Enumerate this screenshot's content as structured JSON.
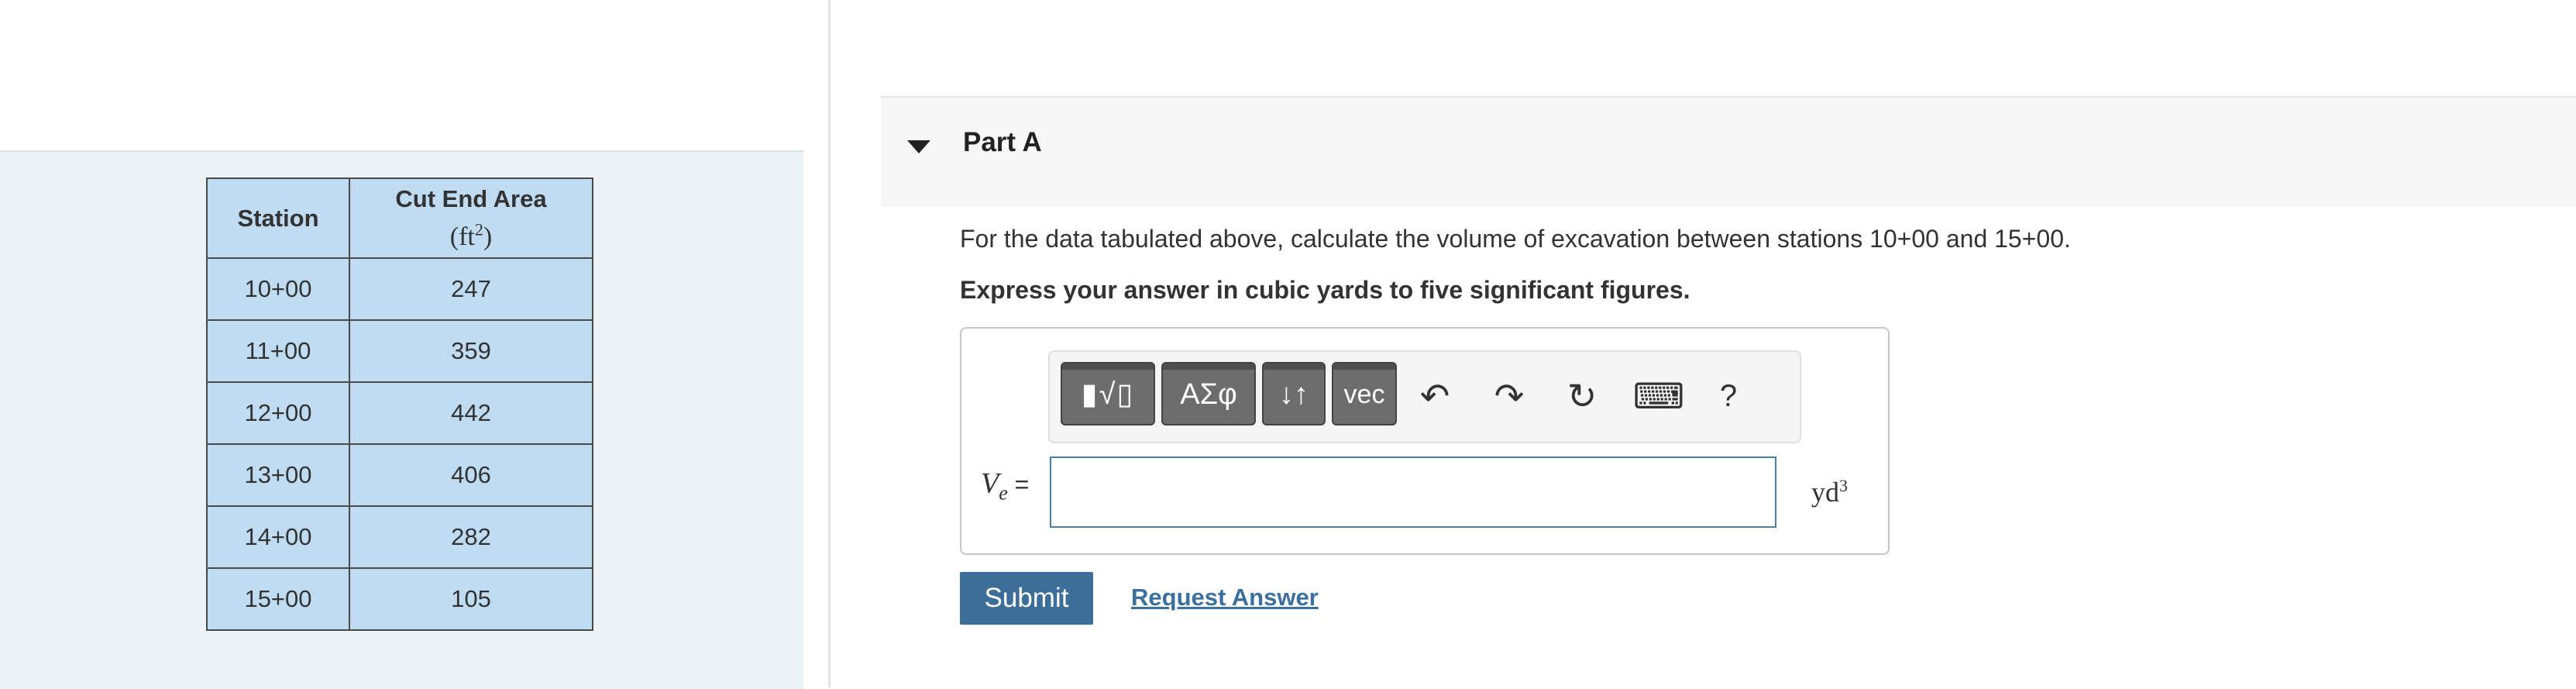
{
  "table": {
    "headers": [
      "Station",
      "Cut End Area"
    ],
    "header_unit_base": "(ft",
    "header_unit_sup": "2",
    "header_unit_close": ")",
    "rows": [
      [
        "10+00",
        "247"
      ],
      [
        "11+00",
        "359"
      ],
      [
        "12+00",
        "442"
      ],
      [
        "13+00",
        "406"
      ],
      [
        "14+00",
        "282"
      ],
      [
        "15+00",
        "105"
      ]
    ]
  },
  "part": {
    "title": "Part A"
  },
  "question": {
    "text": "For the data tabulated above, calculate the volume of excavation between stations 10+00 and 15+00.",
    "instruction": "Express your answer in cubic yards to five significant figures."
  },
  "toolbar": {
    "templates_label": "▮√▯",
    "greek_label": "ΑΣφ",
    "arrows_label": "↓↑",
    "vec_label": "vec",
    "undo_icon": "↶",
    "redo_icon": "↷",
    "reset_icon": "↻",
    "keyboard_icon": "⌨",
    "help_label": "?"
  },
  "answer": {
    "var_main": "V",
    "var_sub": "e",
    "equals": " =",
    "value": "",
    "unit_base": "yd",
    "unit_sup": "3"
  },
  "buttons": {
    "submit": "Submit",
    "request": "Request Answer"
  }
}
